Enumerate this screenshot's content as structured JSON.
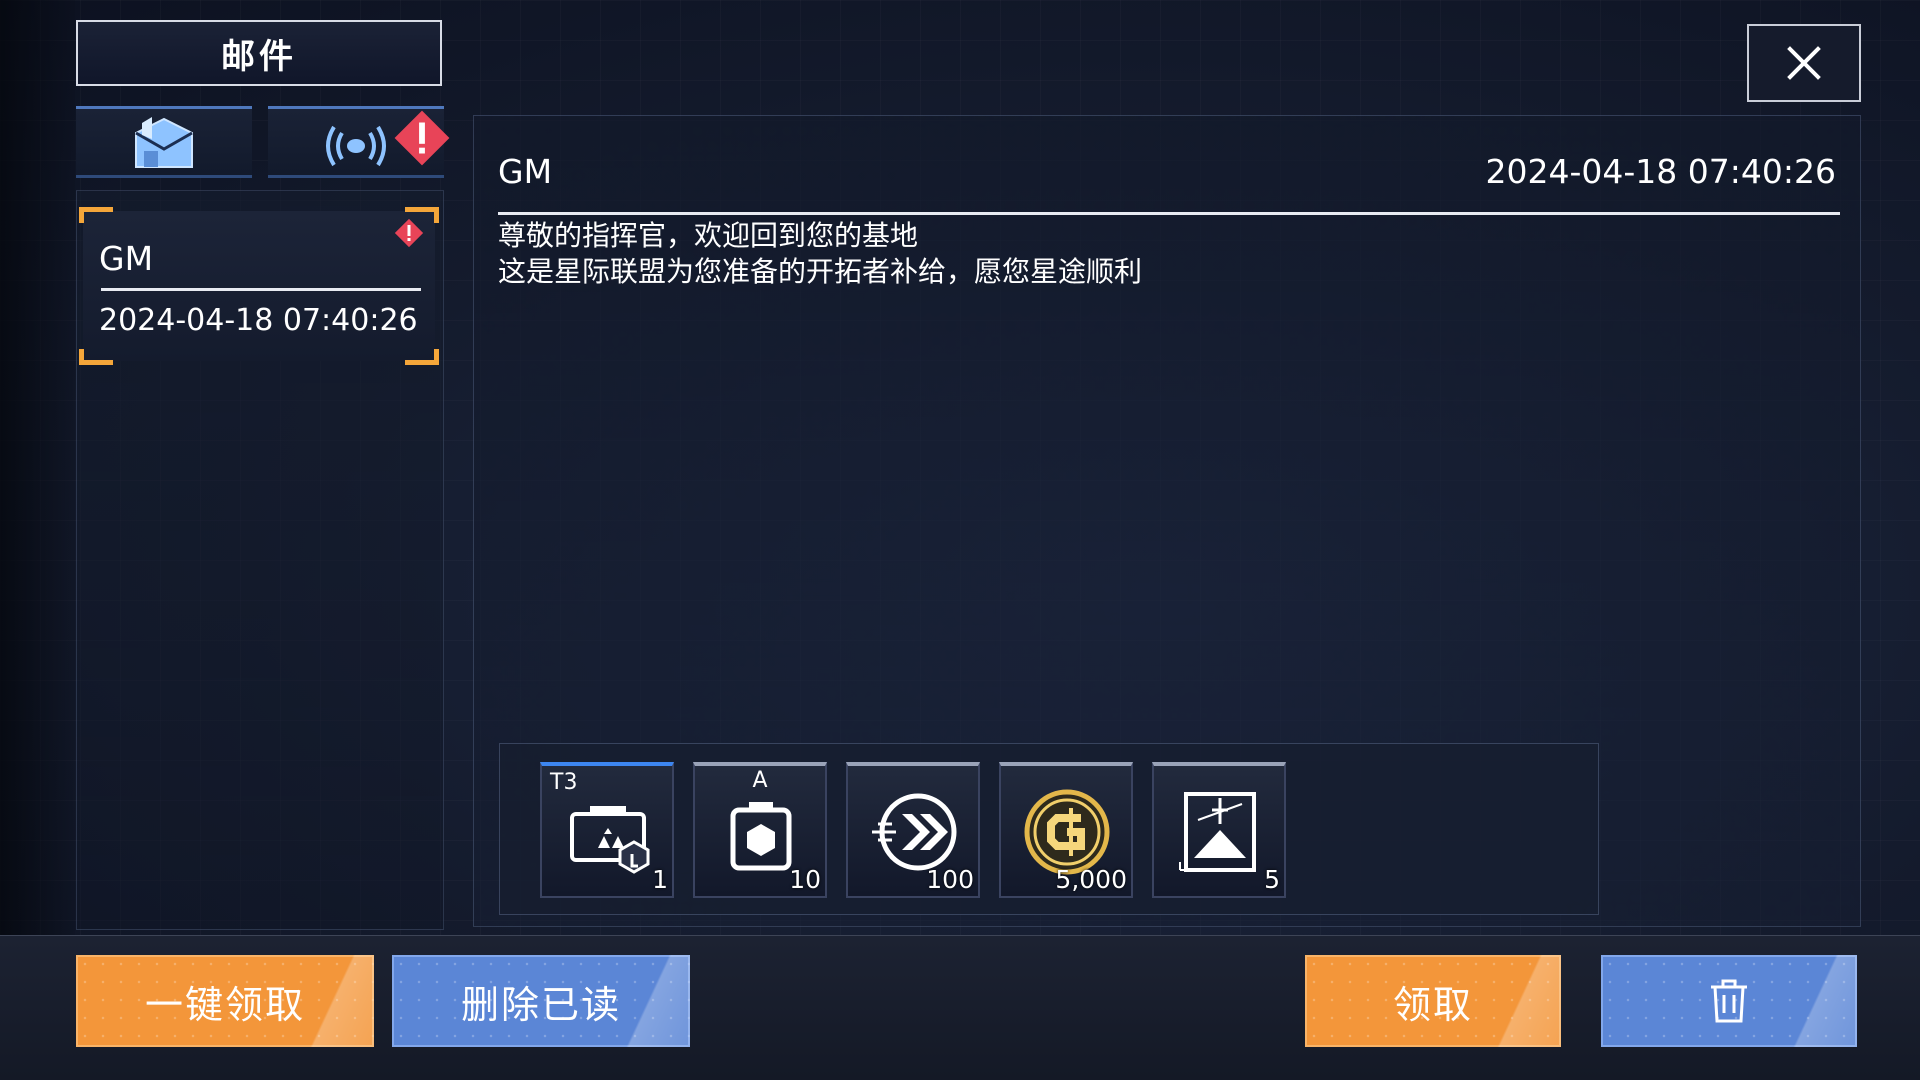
{
  "left_panel": {
    "title": "邮件",
    "tabs": [
      {
        "icon": "mailbox-icon",
        "has_alert": false
      },
      {
        "icon": "broadcast-icon",
        "has_alert": true
      }
    ],
    "mail_list": [
      {
        "sender": "GM",
        "date": "2024-04-18 07:40:26",
        "unread": true,
        "selected": true
      }
    ]
  },
  "mail": {
    "sender": "GM",
    "date": "2024-04-18 07:40:26",
    "body": [
      "尊敬的指挥官，欢迎回到您的基地",
      "这是星际联盟为您准备的开拓者补给，愿您星途顺利"
    ],
    "rewards": [
      {
        "icon": "blueprint-chest-icon",
        "tier": "T3",
        "quantity": "1"
      },
      {
        "icon": "supply-crate-icon",
        "grade": "A",
        "quantity": "10"
      },
      {
        "icon": "speed-boost-icon",
        "quantity": "100"
      },
      {
        "icon": "gold-coin-icon",
        "quantity": "5,000"
      },
      {
        "icon": "mountain-card-icon",
        "quantity": "5"
      }
    ]
  },
  "buttons": {
    "claim_all": "一键领取",
    "delete_read": "删除已读",
    "claim": "领取",
    "delete": "trash-icon"
  },
  "colors": {
    "accent_orange": "#f3963a",
    "accent_blue": "#5b86d6",
    "alert_red": "#e84458",
    "corner_gold": "#f4a63a"
  }
}
